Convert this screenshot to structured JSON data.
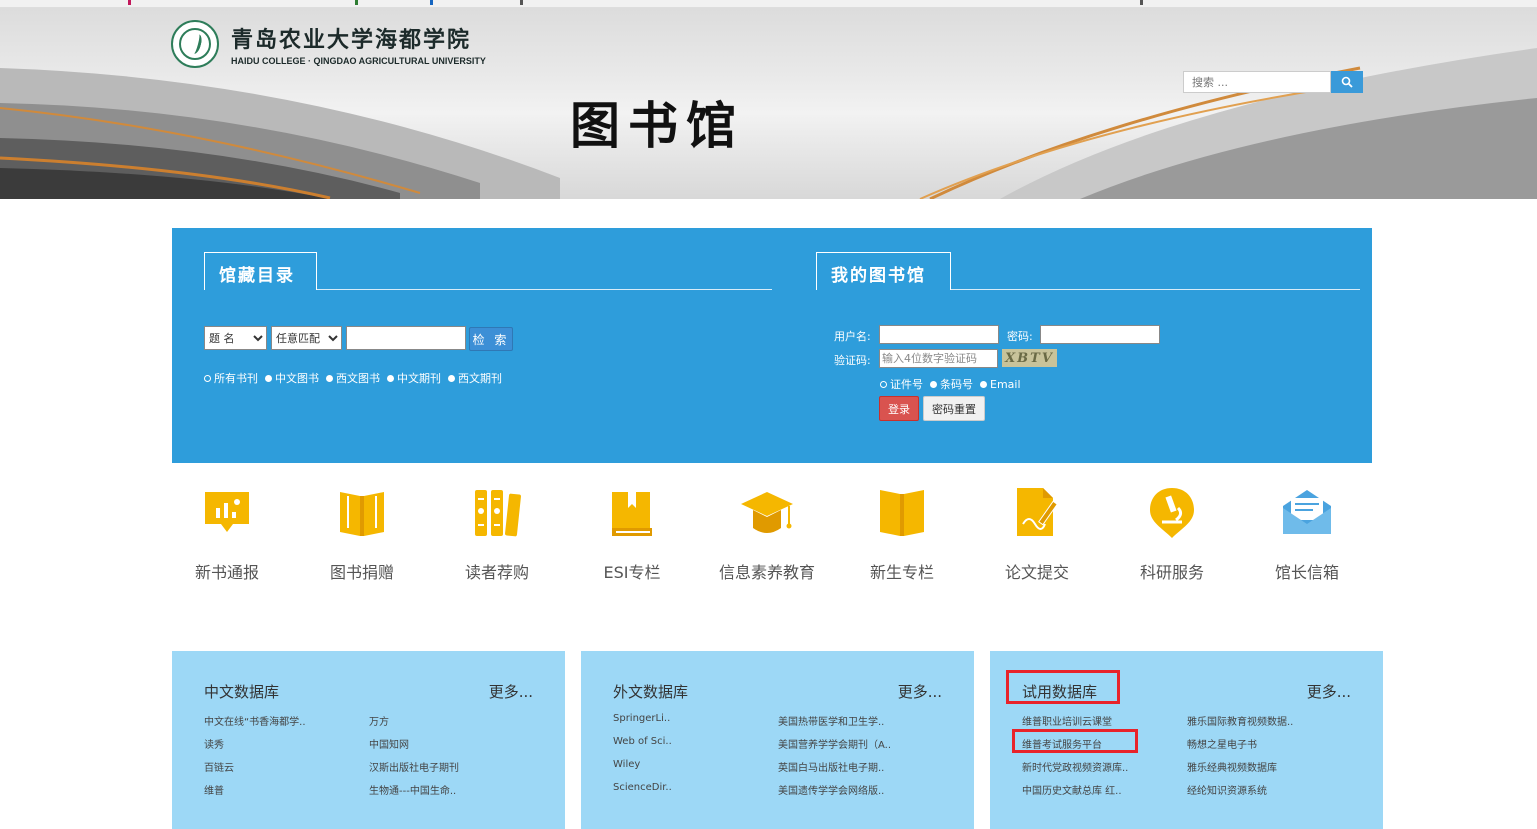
{
  "header": {
    "school_cn": "青岛农业大学海都学院",
    "school_en": "HAIDU COLLEGE · QINGDAO AGRICULTURAL UNIVERSITY",
    "library_title": "图书馆",
    "search_placeholder": "搜索 ..."
  },
  "catalog": {
    "tab_label": "馆藏目录",
    "field_select": "题 名",
    "match_select": "任意匹配",
    "search_button": "检 索",
    "scopes": [
      "所有书刊",
      "中文图书",
      "西文图书",
      "中文期刊",
      "西文期刊"
    ]
  },
  "my_library": {
    "tab_label": "我的图书馆",
    "username_label": "用户名:",
    "password_label": "密码:",
    "captcha_label": "验证码:",
    "captcha_placeholder": "输入4位数字验证码",
    "captcha_image_text": "XBTV",
    "id_types": [
      "证件号",
      "条码号",
      "Email"
    ],
    "login_button": "登录",
    "reset_button": "密码重置"
  },
  "quick_links": [
    {
      "label": "新书通报",
      "icon": "report-icon"
    },
    {
      "label": "图书捐赠",
      "icon": "open-book-icon"
    },
    {
      "label": "读者荐购",
      "icon": "bookshelf-icon"
    },
    {
      "label": "ESI专栏",
      "icon": "book-stack-icon"
    },
    {
      "label": "信息素养教育",
      "icon": "graduation-cap-icon"
    },
    {
      "label": "新生专栏",
      "icon": "reading-book-icon"
    },
    {
      "label": "论文提交",
      "icon": "document-pen-icon"
    },
    {
      "label": "科研服务",
      "icon": "microscope-icon"
    },
    {
      "label": "馆长信箱",
      "icon": "mailbox-icon"
    }
  ],
  "databases": [
    {
      "title": "中文数据库",
      "more": "更多...",
      "rows": [
        [
          "中文在线“书香海都学..",
          "万方"
        ],
        [
          "读秀",
          "中国知网"
        ],
        [
          "百链云",
          "汉斯出版社电子期刊"
        ],
        [
          "维普",
          "生物通---中国生命.."
        ]
      ]
    },
    {
      "title": "外文数据库",
      "more": "更多...",
      "rows": [
        [
          "SpringerLi..",
          "美国热带医学和卫生学.."
        ],
        [
          "Web of Sci..",
          "美国营养学学会期刊（A.."
        ],
        [
          "Wiley",
          "英国白马出版社电子期.."
        ],
        [
          "ScienceDir..",
          "美国遗传学学会网络版.."
        ]
      ]
    },
    {
      "title": "试用数据库",
      "more": "更多...",
      "rows": [
        [
          "维普职业培训云课堂",
          "雅乐国际教育视频数据.."
        ],
        [
          "维普考试服务平台",
          "畅想之星电子书"
        ],
        [
          "新时代党政视频资源库..",
          "雅乐经典视频数据库"
        ],
        [
          "中国历史文献总库 红..",
          "经纶知识资源系统"
        ]
      ]
    }
  ],
  "colors": {
    "panel_blue": "#2e9ddb",
    "db_box_blue": "#9dd8f6",
    "icon_yellow": "#f5b700",
    "mail_blue": "#4aa3df",
    "highlight_red": "#e8232a",
    "login_red": "#d9534f"
  }
}
